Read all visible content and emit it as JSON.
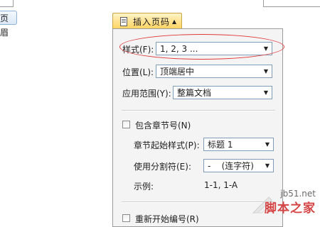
{
  "header_tag": {
    "label": "页眉"
  },
  "popup": {
    "title": "插入页码",
    "fields": {
      "style": {
        "label": "样式(F):",
        "value": "1, 2, 3 ..."
      },
      "position": {
        "label": "位置(L):",
        "value": "顶端居中"
      },
      "scope": {
        "label": "应用范围(Y):",
        "value": "整篇文档"
      }
    },
    "include_chapter": {
      "label": "包含章节号(N)",
      "checked": false,
      "start_style": {
        "label": "章节起始样式(P):",
        "value": "标题 1"
      },
      "separator": {
        "label": "使用分割符(E):",
        "value": "-    (连字符)"
      },
      "example": {
        "label": "示例:",
        "value": "1-1, 1-A"
      }
    },
    "restart_numbering": {
      "label": "重新开始编号(R)",
      "checked": false
    }
  },
  "watermark": {
    "site": "jb51.net",
    "name": "脚本之家"
  },
  "colors": {
    "title_gradient_top": "#fff4c8",
    "title_gradient_bottom": "#ffd25a",
    "combo_border": "#7f9db9",
    "highlight": "#e03a3a",
    "watermark_red": "#d64545"
  }
}
